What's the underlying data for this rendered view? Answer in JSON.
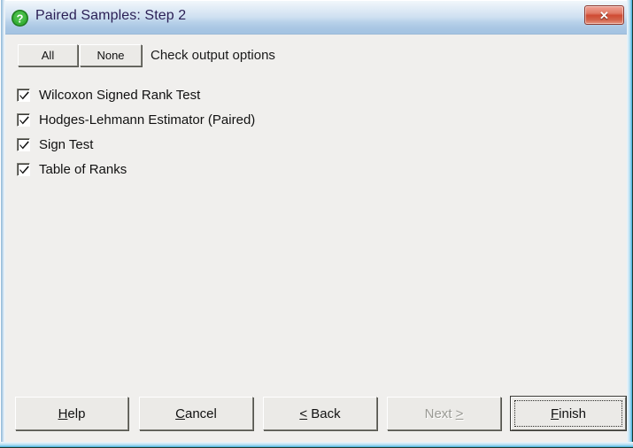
{
  "window": {
    "title": "Paired Samples: Step 2",
    "icon": "question-mark-icon",
    "close_label": "✕",
    "accent_title_color": "#2b1f55",
    "titlebar_color": "#b9d2ea",
    "body_color": "#f0efed",
    "close_button_color": "#cf4a33",
    "icon_color": "#2e9e2e"
  },
  "toolbar": {
    "all_label": "All",
    "none_label": "None",
    "instruction": "Check output options"
  },
  "options": [
    {
      "label": "Wilcoxon Signed Rank Test",
      "checked": true
    },
    {
      "label": "Hodges-Lehmann Estimator (Paired)",
      "checked": true
    },
    {
      "label": "Sign Test",
      "checked": true
    },
    {
      "label": "Table of Ranks",
      "checked": true
    }
  ],
  "footer": {
    "help": {
      "mnemonic": "H",
      "rest": "elp",
      "enabled": true
    },
    "cancel": {
      "mnemonic": "C",
      "rest": "ancel",
      "enabled": true
    },
    "back": {
      "mnemonic": "<",
      "rest": " Back",
      "enabled": true
    },
    "next": {
      "pre": "Next ",
      "mnemonic": ">",
      "enabled": false
    },
    "finish": {
      "mnemonic": "F",
      "rest": "inish",
      "enabled": true,
      "is_default": true
    }
  }
}
